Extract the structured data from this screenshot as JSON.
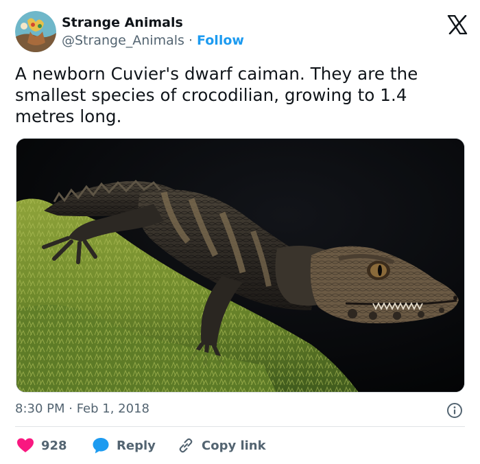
{
  "author": {
    "display_name": "Strange Animals",
    "handle": "@Strange_Animals",
    "separator": "·",
    "follow_label": "Follow"
  },
  "tweet": {
    "text": "A newborn Cuvier's dwarf caiman. They are the smallest species of crocodilian, growing to 1.4 metres long.",
    "timestamp": "8:30 PM · Feb 1, 2018"
  },
  "actions": {
    "like_count": "928",
    "reply_label": "Reply",
    "copy_link_label": "Copy link"
  },
  "icons": {
    "brand": "x-logo-icon",
    "info": "info-icon",
    "like": "heart-icon",
    "reply": "speech-bubble-icon",
    "copy": "link-icon"
  },
  "colors": {
    "accent": "#1d9bf0",
    "like": "#f91880",
    "text": "#0f1419",
    "secondary": "#536471"
  }
}
